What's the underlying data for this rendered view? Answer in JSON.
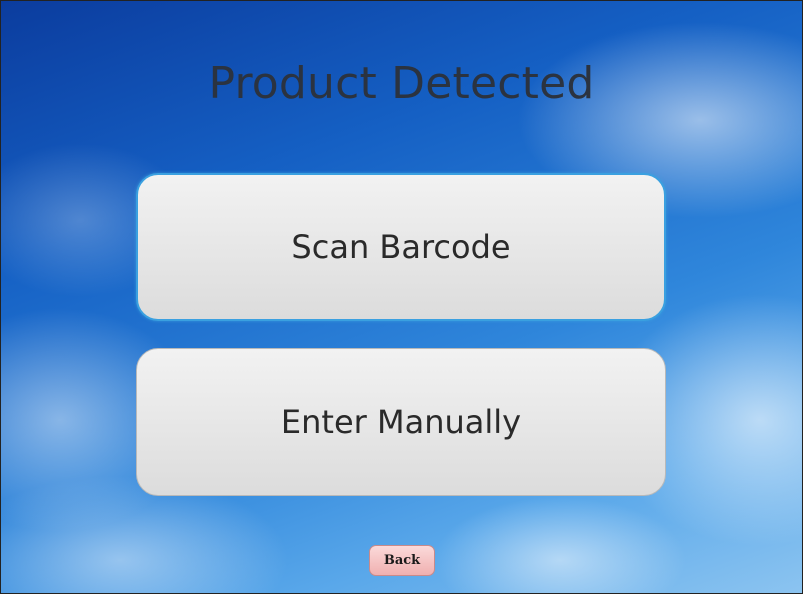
{
  "screen": {
    "title": "Product Detected"
  },
  "buttons": {
    "scan_label": "Scan Barcode",
    "manual_label": "Enter Manually",
    "back_label": "Back"
  },
  "colors": {
    "title_text": "#2b3340",
    "button_focus_border": "#3aa0e0",
    "back_button_bg": "#f0b0b0"
  }
}
